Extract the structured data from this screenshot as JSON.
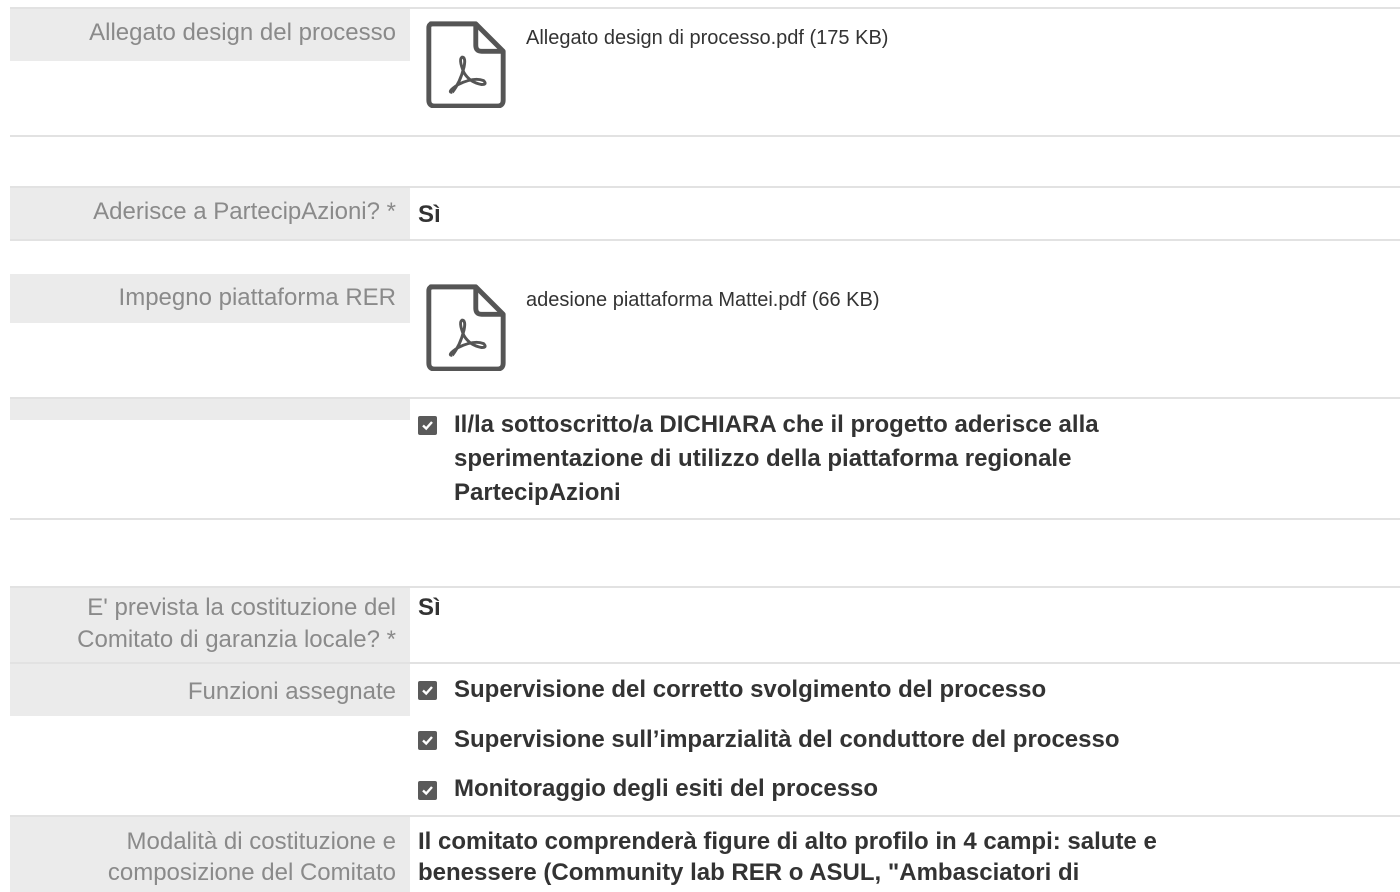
{
  "design_attachment": {
    "label": "Allegato design del processo",
    "file_name": "Allegato design di processo.pdf (175 KB)",
    "icon": "pdf-file-icon"
  },
  "adherence": {
    "label": "Aderisce a PartecipAzioni? *",
    "value": "Sì"
  },
  "platform_commitment": {
    "label": "Impegno piattaforma RER",
    "file_name": "adesione piattaforma Mattei.pdf (66 KB)",
    "icon": "pdf-file-icon"
  },
  "declaration": {
    "checked": true,
    "text_line1": "Il/la sottoscritto/a DICHIARA che il progetto aderisce alla",
    "text_line2": "sperimentazione di utilizzo della piattaforma regionale",
    "text_line3": "PartecipAzioni"
  },
  "committee": {
    "label_line1": "E' prevista la costituzione del",
    "label_line2": "Comitato di garanzia locale? *",
    "value": "Sì"
  },
  "functions": {
    "label": "Funzioni assegnate",
    "items": [
      {
        "text": "Supervisione del corretto svolgimento del processo",
        "checked": true
      },
      {
        "text": "Supervisione sull’imparzialità del conduttore del processo",
        "checked": true
      },
      {
        "text": "Monitoraggio degli esiti del processo",
        "checked": true
      }
    ]
  },
  "composition": {
    "label_line1": "Modalità di costituzione e",
    "label_line2": "composizione del Comitato",
    "text_line1": "Il comitato comprenderà figure di alto profilo in 4 campi: salute e",
    "text_line2": "benessere (Community lab RER o ASUL, \"Ambasciatori di"
  },
  "colors": {
    "label_bg": "#ebebeb",
    "label_text": "#8a8a8a",
    "value_text": "#333333",
    "divider": "#e2e2e2",
    "checkbox": "#5a5a5a"
  }
}
